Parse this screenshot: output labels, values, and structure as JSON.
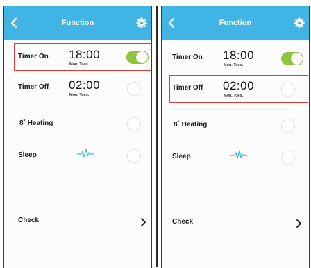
{
  "screens": [
    {
      "header": {
        "title": "Function"
      },
      "timer_on": {
        "label": "Timer On",
        "time": "18:00",
        "days": "Mon. Tues.",
        "enabled": true,
        "highlighted": true
      },
      "timer_off": {
        "label": "Timer Off",
        "time": "02:00",
        "days": "Mon. Tues.",
        "enabled": false,
        "highlighted": false
      },
      "heating": {
        "label": "8˚ Heating",
        "enabled": false
      },
      "sleep": {
        "label": "Sleep",
        "icon": "sleep-wave-icon",
        "enabled": false
      },
      "check": {
        "label": "Check"
      }
    },
    {
      "header": {
        "title": "Function"
      },
      "timer_on": {
        "label": "Timer On",
        "time": "18:00",
        "days": "Mon. Tues.",
        "enabled": true,
        "highlighted": false
      },
      "timer_off": {
        "label": "Timer Off",
        "time": "02:00",
        "days": "Mon. Tues.",
        "enabled": false,
        "highlighted": true
      },
      "heating": {
        "label": "8˚ Heating",
        "enabled": false
      },
      "sleep": {
        "label": "Sleep",
        "icon": "sleep-wave-icon",
        "enabled": false
      },
      "check": {
        "label": "Check"
      }
    }
  ],
  "colors": {
    "header": "#41b4e6",
    "toggle_on": "#8cc63f",
    "highlight": "#d93a3a",
    "sleep_icon": "#41b4e6"
  }
}
